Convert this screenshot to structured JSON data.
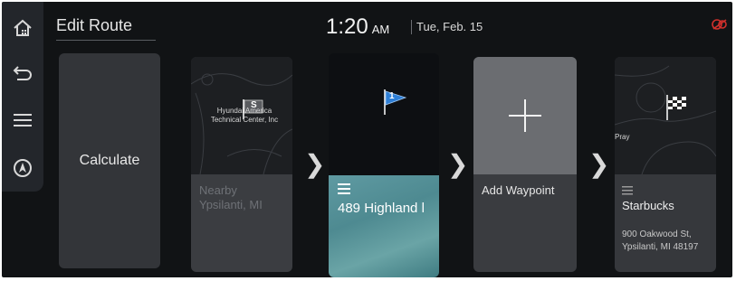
{
  "header": {
    "title": "Edit Route",
    "time": "1:20",
    "ampm": "AM",
    "date": "Tue, Feb. 15"
  },
  "sidebar": {
    "items": [
      {
        "icon": "home-icon"
      },
      {
        "icon": "back-icon"
      },
      {
        "icon": "menu-icon"
      },
      {
        "icon": "navigation-icon"
      }
    ]
  },
  "cards": {
    "calculate": {
      "label": "Calculate"
    },
    "nearby": {
      "line1": "Nearby",
      "line2": "Ypsilanti, MI",
      "map_line1": "Hyundai America",
      "map_line2": "Technical Center, Inc",
      "start_badge": "S"
    },
    "current": {
      "label": "489 Highland l",
      "waypoint_number": "1"
    },
    "add_waypoint": {
      "label": "Add Waypoint"
    },
    "destination": {
      "label": "Starbucks",
      "addr_line1": "900 Oakwood St,",
      "addr_line2": "Ypsilanti, MI 48197",
      "map_text": "Pray"
    }
  },
  "colors": {
    "screen_bg": "#111315",
    "warning": "#d0302c",
    "waypoint_flag": "#2e7fd6",
    "card_map": "#1d1f22"
  }
}
